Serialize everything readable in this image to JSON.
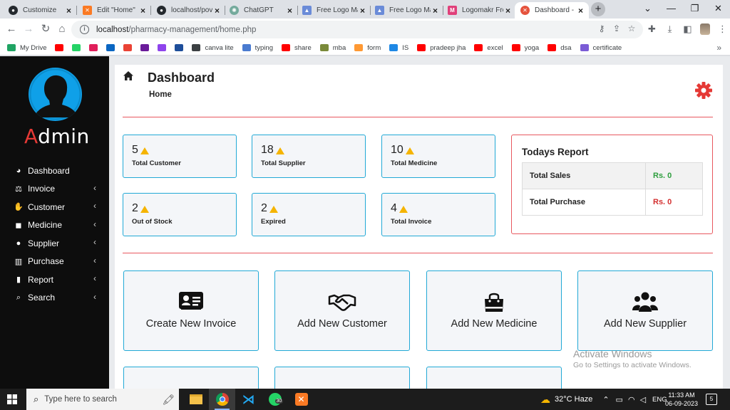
{
  "browser": {
    "tabs": [
      {
        "label": "Customize",
        "icon": "github-icon",
        "color": "#24292e",
        "active": false
      },
      {
        "label": "Edit \"Home\"",
        "icon": "xampp-icon",
        "color": "#fb7a24",
        "active": false
      },
      {
        "label": "localhost/pov",
        "icon": "github-icon",
        "color": "#24292e",
        "active": false
      },
      {
        "label": "ChatGPT",
        "icon": "chatgpt-icon",
        "color": "#74aa9c",
        "active": false
      },
      {
        "label": "Free Logo Ma",
        "icon": "logo-maker-icon",
        "color": "#6a8bd8",
        "active": false
      },
      {
        "label": "Free Logo Ma",
        "icon": "logo-maker-icon",
        "color": "#6a8bd8",
        "active": false
      },
      {
        "label": "Logomakr Fre",
        "icon": "logomakr-icon",
        "color": "#e0407a",
        "active": false
      },
      {
        "label": "Dashboard - ",
        "icon": "xampp-icon",
        "color": "#e5533d",
        "active": true
      }
    ],
    "url_host": "localhost",
    "url_path": "/pharmacy-management/home.php",
    "bookmarks": [
      {
        "label": "My Drive",
        "icon": "google-drive-icon",
        "color": "#1fa463"
      },
      {
        "label": "",
        "icon": "youtube-icon",
        "color": "#ff0000"
      },
      {
        "label": "",
        "icon": "whatsapp-icon",
        "color": "#25d366"
      },
      {
        "label": "",
        "icon": "slack-icon",
        "color": "#e01e5a"
      },
      {
        "label": "",
        "icon": "linkedin-icon",
        "color": "#0a66c2"
      },
      {
        "label": "",
        "icon": "gmail-icon",
        "color": "#ea4335"
      },
      {
        "label": "",
        "icon": "upwork-icon",
        "color": "#6a1b9a"
      },
      {
        "label": "",
        "icon": "messenger-icon",
        "color": "#8e44ec"
      },
      {
        "label": "",
        "icon": "bookmark-triangle-icon",
        "color": "#1e4e9a"
      },
      {
        "label": "canva lite",
        "icon": "canva-icon",
        "color": "#3c4043"
      },
      {
        "label": "typing",
        "icon": "typing-icon",
        "color": "#4a7bd0"
      },
      {
        "label": "share",
        "icon": "youtube-icon",
        "color": "#ff0000"
      },
      {
        "label": "mba",
        "icon": "mba-icon",
        "color": "#7a8a3a"
      },
      {
        "label": "form",
        "icon": "india-flag-icon",
        "color": "#ff9933"
      },
      {
        "label": "IS",
        "icon": "is-icon",
        "color": "#1e88e5"
      },
      {
        "label": "pradeep jha",
        "icon": "youtube-icon",
        "color": "#ff0000"
      },
      {
        "label": "excel",
        "icon": "youtube-icon",
        "color": "#ff0000"
      },
      {
        "label": "yoga",
        "icon": "youtube-icon",
        "color": "#ff0000"
      },
      {
        "label": "dsa",
        "icon": "youtube-icon",
        "color": "#ff0000"
      },
      {
        "label": "certificate",
        "icon": "certificate-icon",
        "color": "#7b5cd6"
      }
    ]
  },
  "sidebar": {
    "title_first": "A",
    "title_rest": "dmin",
    "items": [
      {
        "label": "Dashboard",
        "icon": "dashboard-icon",
        "glyph": "◕",
        "has_submenu": false
      },
      {
        "label": "Invoice",
        "icon": "balance-scale-icon",
        "glyph": "⚖",
        "has_submenu": true
      },
      {
        "label": "Customer",
        "icon": "handshake-icon",
        "glyph": "✋",
        "has_submenu": true
      },
      {
        "label": "Medicine",
        "icon": "shopping-bag-icon",
        "glyph": "◼",
        "has_submenu": true
      },
      {
        "label": "Supplier",
        "icon": "users-icon",
        "glyph": "●",
        "has_submenu": true
      },
      {
        "label": "Purchase",
        "icon": "bar-chart-icon",
        "glyph": "▥",
        "has_submenu": true
      },
      {
        "label": "Report",
        "icon": "book-icon",
        "glyph": "▮",
        "has_submenu": true
      },
      {
        "label": "Search",
        "icon": "search-icon",
        "glyph": "⌕",
        "has_submenu": true
      }
    ]
  },
  "header": {
    "title": "Dashboard",
    "breadcrumb": "Home"
  },
  "stats": [
    {
      "value": "5",
      "label": "Total Customer"
    },
    {
      "value": "18",
      "label": "Total Supplier"
    },
    {
      "value": "10",
      "label": "Total Medicine"
    },
    {
      "value": "2",
      "label": "Out of Stock"
    },
    {
      "value": "2",
      "label": "Expired"
    },
    {
      "value": "4",
      "label": "Total Invoice"
    }
  ],
  "report": {
    "title": "Todays Report",
    "rows": [
      {
        "label": "Total Sales",
        "value": "Rs. 0",
        "color": "#2e9e3e"
      },
      {
        "label": "Total Purchase",
        "value": "Rs. 0",
        "color": "#d32f2f"
      }
    ]
  },
  "actions": [
    {
      "label": "Create New Invoice",
      "icon": "id-card-icon"
    },
    {
      "label": "Add New Customer",
      "icon": "handshake-icon"
    },
    {
      "label": "Add New Medicine",
      "icon": "shopping-bag-icon"
    },
    {
      "label": "Add New Supplier",
      "icon": "users-icon"
    }
  ],
  "watermark": {
    "line1": "Activate Windows",
    "line2": "Go to Settings to activate Windows."
  },
  "taskbar": {
    "search_placeholder": "Type here to search",
    "whatsapp_badge": "30",
    "weather": "32°C  Haze",
    "language": "ENG",
    "time": "11:33 AM",
    "date": "06-09-2023",
    "notifications": "5"
  },
  "colors": {
    "accent_blue": "#22a9d6",
    "accent_red": "#e8585f",
    "gear_red": "#e53935",
    "warning_yellow": "#f5b400",
    "sidebar_bg": "#0d0d0d"
  }
}
